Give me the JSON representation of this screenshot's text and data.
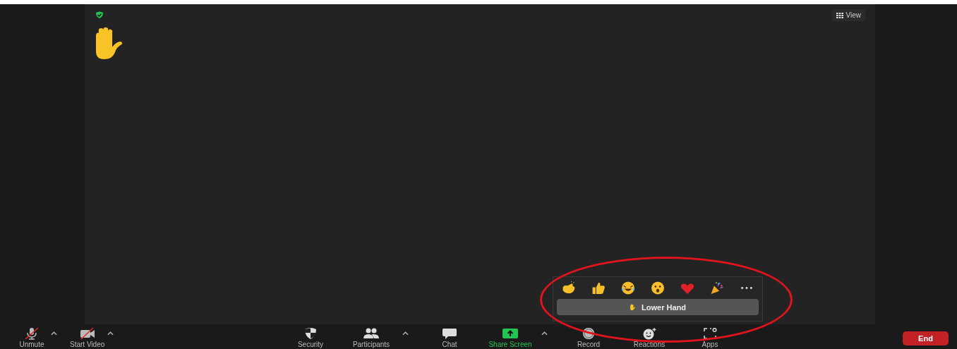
{
  "top_right": {
    "view_button": "View"
  },
  "reaction_popup": {
    "reactions": [
      {
        "kind": "clap"
      },
      {
        "kind": "thumbs"
      },
      {
        "kind": "laugh"
      },
      {
        "kind": "wow"
      },
      {
        "kind": "heart"
      },
      {
        "kind": "party"
      },
      {
        "kind": "more"
      }
    ],
    "lower_hand_button": "Lower Hand"
  },
  "toolbar": {
    "left": [
      {
        "kind": "mic",
        "label": "Unmute",
        "caret": true
      },
      {
        "kind": "video",
        "label": "Start Video",
        "caret": true
      }
    ],
    "center": [
      {
        "kind": "security",
        "label": "Security",
        "caret": false
      },
      {
        "kind": "participants",
        "label": "Participants",
        "caret": true
      },
      {
        "kind": "chat",
        "label": "Chat",
        "caret": false
      },
      {
        "kind": "share",
        "label": "Share Screen",
        "caret": true
      },
      {
        "kind": "record",
        "label": "Record",
        "caret": false
      },
      {
        "kind": "reactions",
        "label": "Reactions",
        "caret": false
      },
      {
        "kind": "apps",
        "label": "Apps",
        "caret": false
      }
    ],
    "end_button": "End"
  }
}
